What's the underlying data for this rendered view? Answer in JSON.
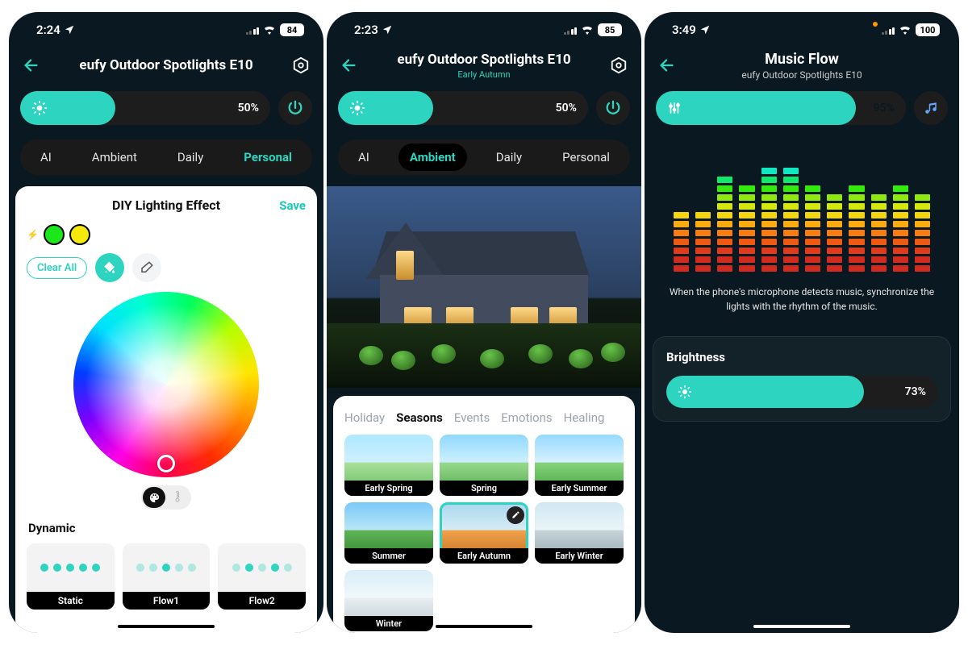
{
  "screen1": {
    "status": {
      "time": "2:24",
      "battery": "84"
    },
    "title": "eufy Outdoor Spotlights E10",
    "brightness_pct": "50%",
    "brightness_fill": 38,
    "tabs": [
      "AI",
      "Ambient",
      "Daily",
      "Personal"
    ],
    "active_tab": 3,
    "card_title": "DIY Lighting Effect",
    "save": "Save",
    "clear_all": "Clear All",
    "section": "Dynamic",
    "dynamic": [
      "Static",
      "Flow1",
      "Flow2"
    ]
  },
  "screen2": {
    "status": {
      "time": "2:23",
      "battery": "85"
    },
    "title": "eufy Outdoor Spotlights E10",
    "subtitle": "Early Autumn",
    "brightness_pct": "50%",
    "brightness_fill": 38,
    "tabs": [
      "AI",
      "Ambient",
      "Daily",
      "Personal"
    ],
    "active_tab": 1,
    "preset_tabs": [
      "Holiday",
      "Seasons",
      "Events",
      "Emotions",
      "Healing"
    ],
    "preset_active": 1,
    "presets": [
      "Early Spring",
      "Spring",
      "Early Summer",
      "Summer",
      "Early Autumn",
      "Early Winter",
      "Winter"
    ],
    "preset_selected": 4
  },
  "screen3": {
    "status": {
      "time": "3:49",
      "battery": "100"
    },
    "title": "Music Flow",
    "subtitle": "eufy Outdoor Spotlights E10",
    "level_pct": "95%",
    "level_fill": 80,
    "description": "When the phone's microphone detects music, synchronize the lights with the rhythm of the music.",
    "brightness_label": "Brightness",
    "brightness_pct": "73%",
    "brightness_fill": 73,
    "eq_heights": [
      7,
      7,
      11,
      10,
      12,
      12,
      10,
      9,
      10,
      9,
      10,
      9
    ]
  },
  "eq_colors": [
    "#d12b1f",
    "#e03a1a",
    "#ee5a13",
    "#f97d0e",
    "#fbaa10",
    "#d4e80f",
    "#8fe80f",
    "#35e80f",
    "#0fe86b",
    "#0fe8c0",
    "#0fb8e8",
    "#0f73e8"
  ],
  "preset_bg": [
    "linear-gradient(#aee9ff 0%,#ceeffd 45%,#a9e09b 46%,#63b85e 100%)",
    "linear-gradient(#8fd9ff 0%,#cdeffd 45%,#96d98c 46%,#4fa74a 100%)",
    "linear-gradient(#96d9ff 0%,#d7f1ff 45%,#87d37c 46%,#3f9e3b 100%)",
    "linear-gradient(#7ac8f8 0%,#b9e6f7 45%,#5fb556 46%,#2d7a29 100%)",
    "linear-gradient(#a7d7ef 0%,#d6ecf5 45%,#f0a24a 46%,#c26a1e 100%)",
    "linear-gradient(#cfe8f3 0%,#eaf4f8 45%,#c7d5da 46%,#8fa3ab 100%)",
    "linear-gradient(#d9eef7 0%,#f0f8fb 45%,#e8eef1 46%,#b8c6cd 100%)"
  ]
}
